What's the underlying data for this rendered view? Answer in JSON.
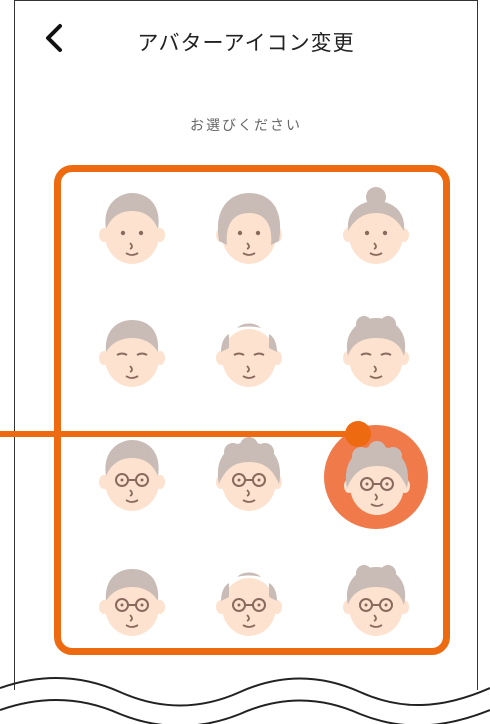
{
  "header": {
    "title": "アバターアイコン変更",
    "back_icon": "chevron-left-icon"
  },
  "subtitle": "お選びください",
  "colors": {
    "accent": "#ee6a10",
    "selected": "#f07a4a",
    "hair": "#c9bbb5",
    "skin": "#fde3cf",
    "face_line": "#8a6a5e"
  },
  "avatars": [
    {
      "name": "avatar-man-short-hair",
      "hair": "short",
      "glasses": false,
      "selected": false
    },
    {
      "name": "avatar-woman-bob",
      "hair": "bob",
      "glasses": false,
      "selected": false
    },
    {
      "name": "avatar-woman-bun",
      "hair": "bun",
      "glasses": false,
      "selected": false
    },
    {
      "name": "avatar-elder-man-short",
      "hair": "elder",
      "glasses": false,
      "selected": false
    },
    {
      "name": "avatar-elder-man-bald",
      "hair": "bald",
      "glasses": false,
      "selected": false
    },
    {
      "name": "avatar-elder-woman-wavy",
      "hair": "wavy",
      "glasses": false,
      "selected": false
    },
    {
      "name": "avatar-man-glasses",
      "hair": "short",
      "glasses": true,
      "selected": false
    },
    {
      "name": "avatar-woman-glasses",
      "hair": "curly",
      "glasses": true,
      "selected": false
    },
    {
      "name": "avatar-elder-woman-glasses",
      "hair": "curly",
      "glasses": true,
      "selected": true
    },
    {
      "name": "avatar-elder-man-glasses",
      "hair": "elder",
      "glasses": true,
      "selected": false
    },
    {
      "name": "avatar-elder-man-bald-glasses",
      "hair": "bald",
      "glasses": true,
      "selected": false
    },
    {
      "name": "avatar-elder-woman-wavy-glasses",
      "hair": "wavy",
      "glasses": true,
      "selected": false
    }
  ]
}
